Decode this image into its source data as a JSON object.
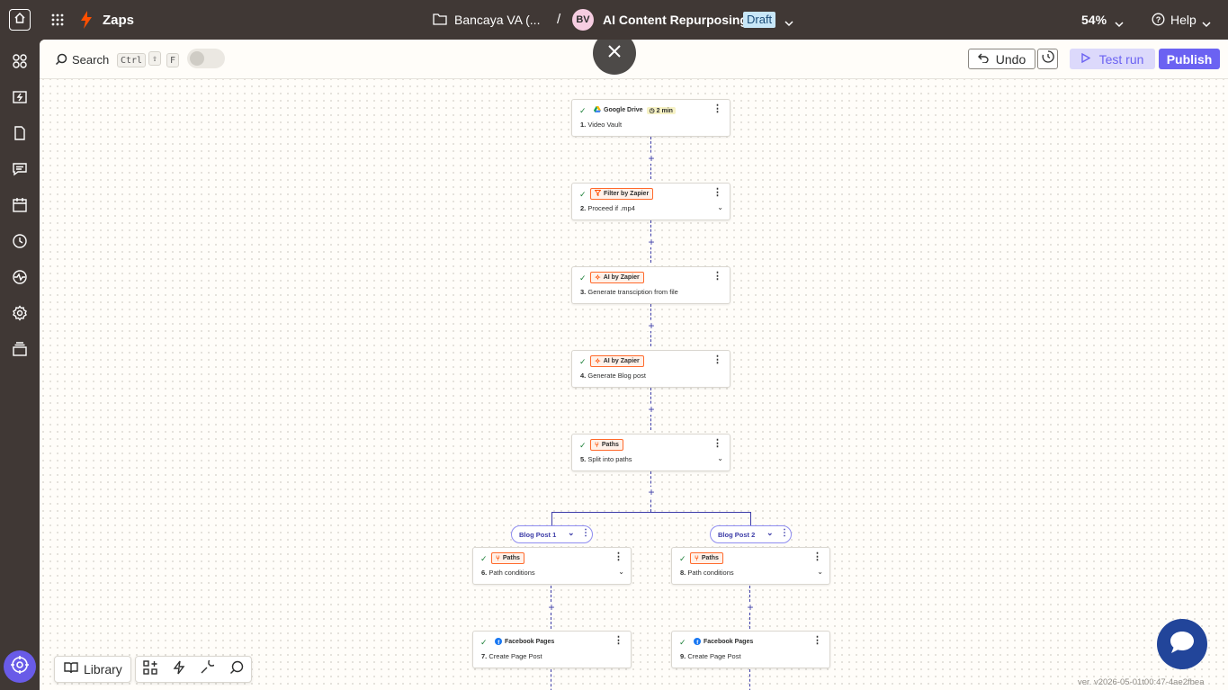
{
  "topbar": {
    "app_name": "Zaps",
    "folder": "Bancaya VA (...",
    "separator": "/",
    "avatar_initials": "BV",
    "zap_name": "AI Content Repurposing",
    "status_badge": "Draft",
    "zoom": "54%",
    "help": "Help"
  },
  "toolbar": {
    "search_label": "Search",
    "shortcut_ctrl": "Ctrl",
    "shortcut_shift": "⇧",
    "shortcut_f": "F",
    "undo_label": "Undo",
    "test_run_label": "Test run",
    "publish_label": "Publish"
  },
  "sidebar": {
    "items": [
      "apps-icon",
      "zaps-icon",
      "tables-icon",
      "interfaces-icon",
      "canvas-icon",
      "history-icon",
      "activity-icon",
      "settings-icon",
      "stack-icon"
    ]
  },
  "steps": [
    {
      "app": "Google Drive",
      "num": "1.",
      "title": "Video Vault",
      "duration": "2 min",
      "icon": "google-drive-icon"
    },
    {
      "app": "Filter by Zapier",
      "num": "2.",
      "title": "Proceed if .mp4",
      "icon": "filter-icon"
    },
    {
      "app": "AI by Zapier",
      "num": "3.",
      "title": "Generate transciption from file",
      "icon": "ai-sparkle-icon"
    },
    {
      "app": "AI by Zapier",
      "num": "4.",
      "title": "Generate Blog post",
      "icon": "ai-sparkle-icon"
    },
    {
      "app": "Paths",
      "num": "5.",
      "title": "Split into paths",
      "icon": "paths-icon"
    },
    {
      "app": "Paths",
      "num": "6.",
      "title": "Path conditions",
      "icon": "paths-icon"
    },
    {
      "app": "Facebook Pages",
      "num": "7.",
      "title": "Create Page Post",
      "icon": "facebook-icon"
    },
    {
      "app": "Paths",
      "num": "8.",
      "title": "Path conditions",
      "icon": "paths-icon"
    },
    {
      "app": "Facebook Pages",
      "num": "9.",
      "title": "Create Page Post",
      "icon": "facebook-icon"
    }
  ],
  "paths": [
    {
      "label": "Blog Post 1"
    },
    {
      "label": "Blog Post 2"
    }
  ],
  "bottom_toolbar": {
    "library_label": "Library"
  },
  "version": "ver. v2026-05-01t00:47-4ae2fbea",
  "colors": {
    "accent": "#6b62f2",
    "zapier_orange": "#ff4f00",
    "sidebar_bg": "#403835",
    "line": "#3d3da8"
  }
}
